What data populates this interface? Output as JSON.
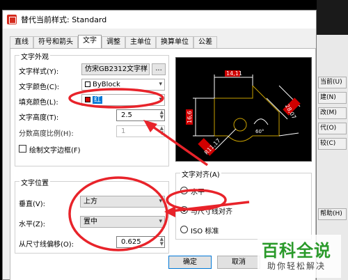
{
  "window": {
    "title": "替代当前样式: Standard"
  },
  "side_buttons": [
    "当前(U)",
    "建(N)",
    "改(M)",
    "代(O)",
    "较(C)",
    "帮助(H)"
  ],
  "tabs": [
    "直线",
    "符号和箭头",
    "文字",
    "调整",
    "主单位",
    "换算单位",
    "公差"
  ],
  "active_tab": "文字",
  "text_appearance": {
    "group_title": "文字外观",
    "style_label": "文字样式(Y):",
    "style_value": "仿宋GB2312文字样",
    "style_button": "...",
    "color_label": "文字颜色(C):",
    "color_value": "ByBlock",
    "fill_label": "填充颜色(L):",
    "fill_value": "红",
    "fill_color": "#d00000",
    "height_label": "文字高度(T):",
    "height_value": "2.5",
    "fraction_label": "分数高度比例(H):",
    "fraction_value": "1",
    "frame_label": "绘制文字边框(F)"
  },
  "text_position": {
    "group_title": "文字位置",
    "vertical_label": "垂直(V):",
    "vertical_value": "上方",
    "horizontal_label": "水平(Z):",
    "horizontal_value": "置中",
    "offset_label": "从尺寸线偏移(O):",
    "offset_value": "0.625"
  },
  "text_alignment": {
    "group_title": "文字对齐(A)",
    "options": [
      "水平",
      "与尺寸线对齐",
      "ISO 标准"
    ],
    "selected": "与尺寸线对齐"
  },
  "preview": {
    "labels": [
      "14,11",
      "16,6",
      "28,07",
      "R11,17",
      "60°"
    ],
    "line_color": "#ffffff",
    "dim_color": "#d00000",
    "accent_color": "#c8a000"
  },
  "footer": {
    "ok_label": "确定",
    "cancel_label": "取消"
  },
  "annotation_color": "#e8232a",
  "watermark": {
    "main": "百科全说",
    "sub": "助你轻松解决"
  }
}
